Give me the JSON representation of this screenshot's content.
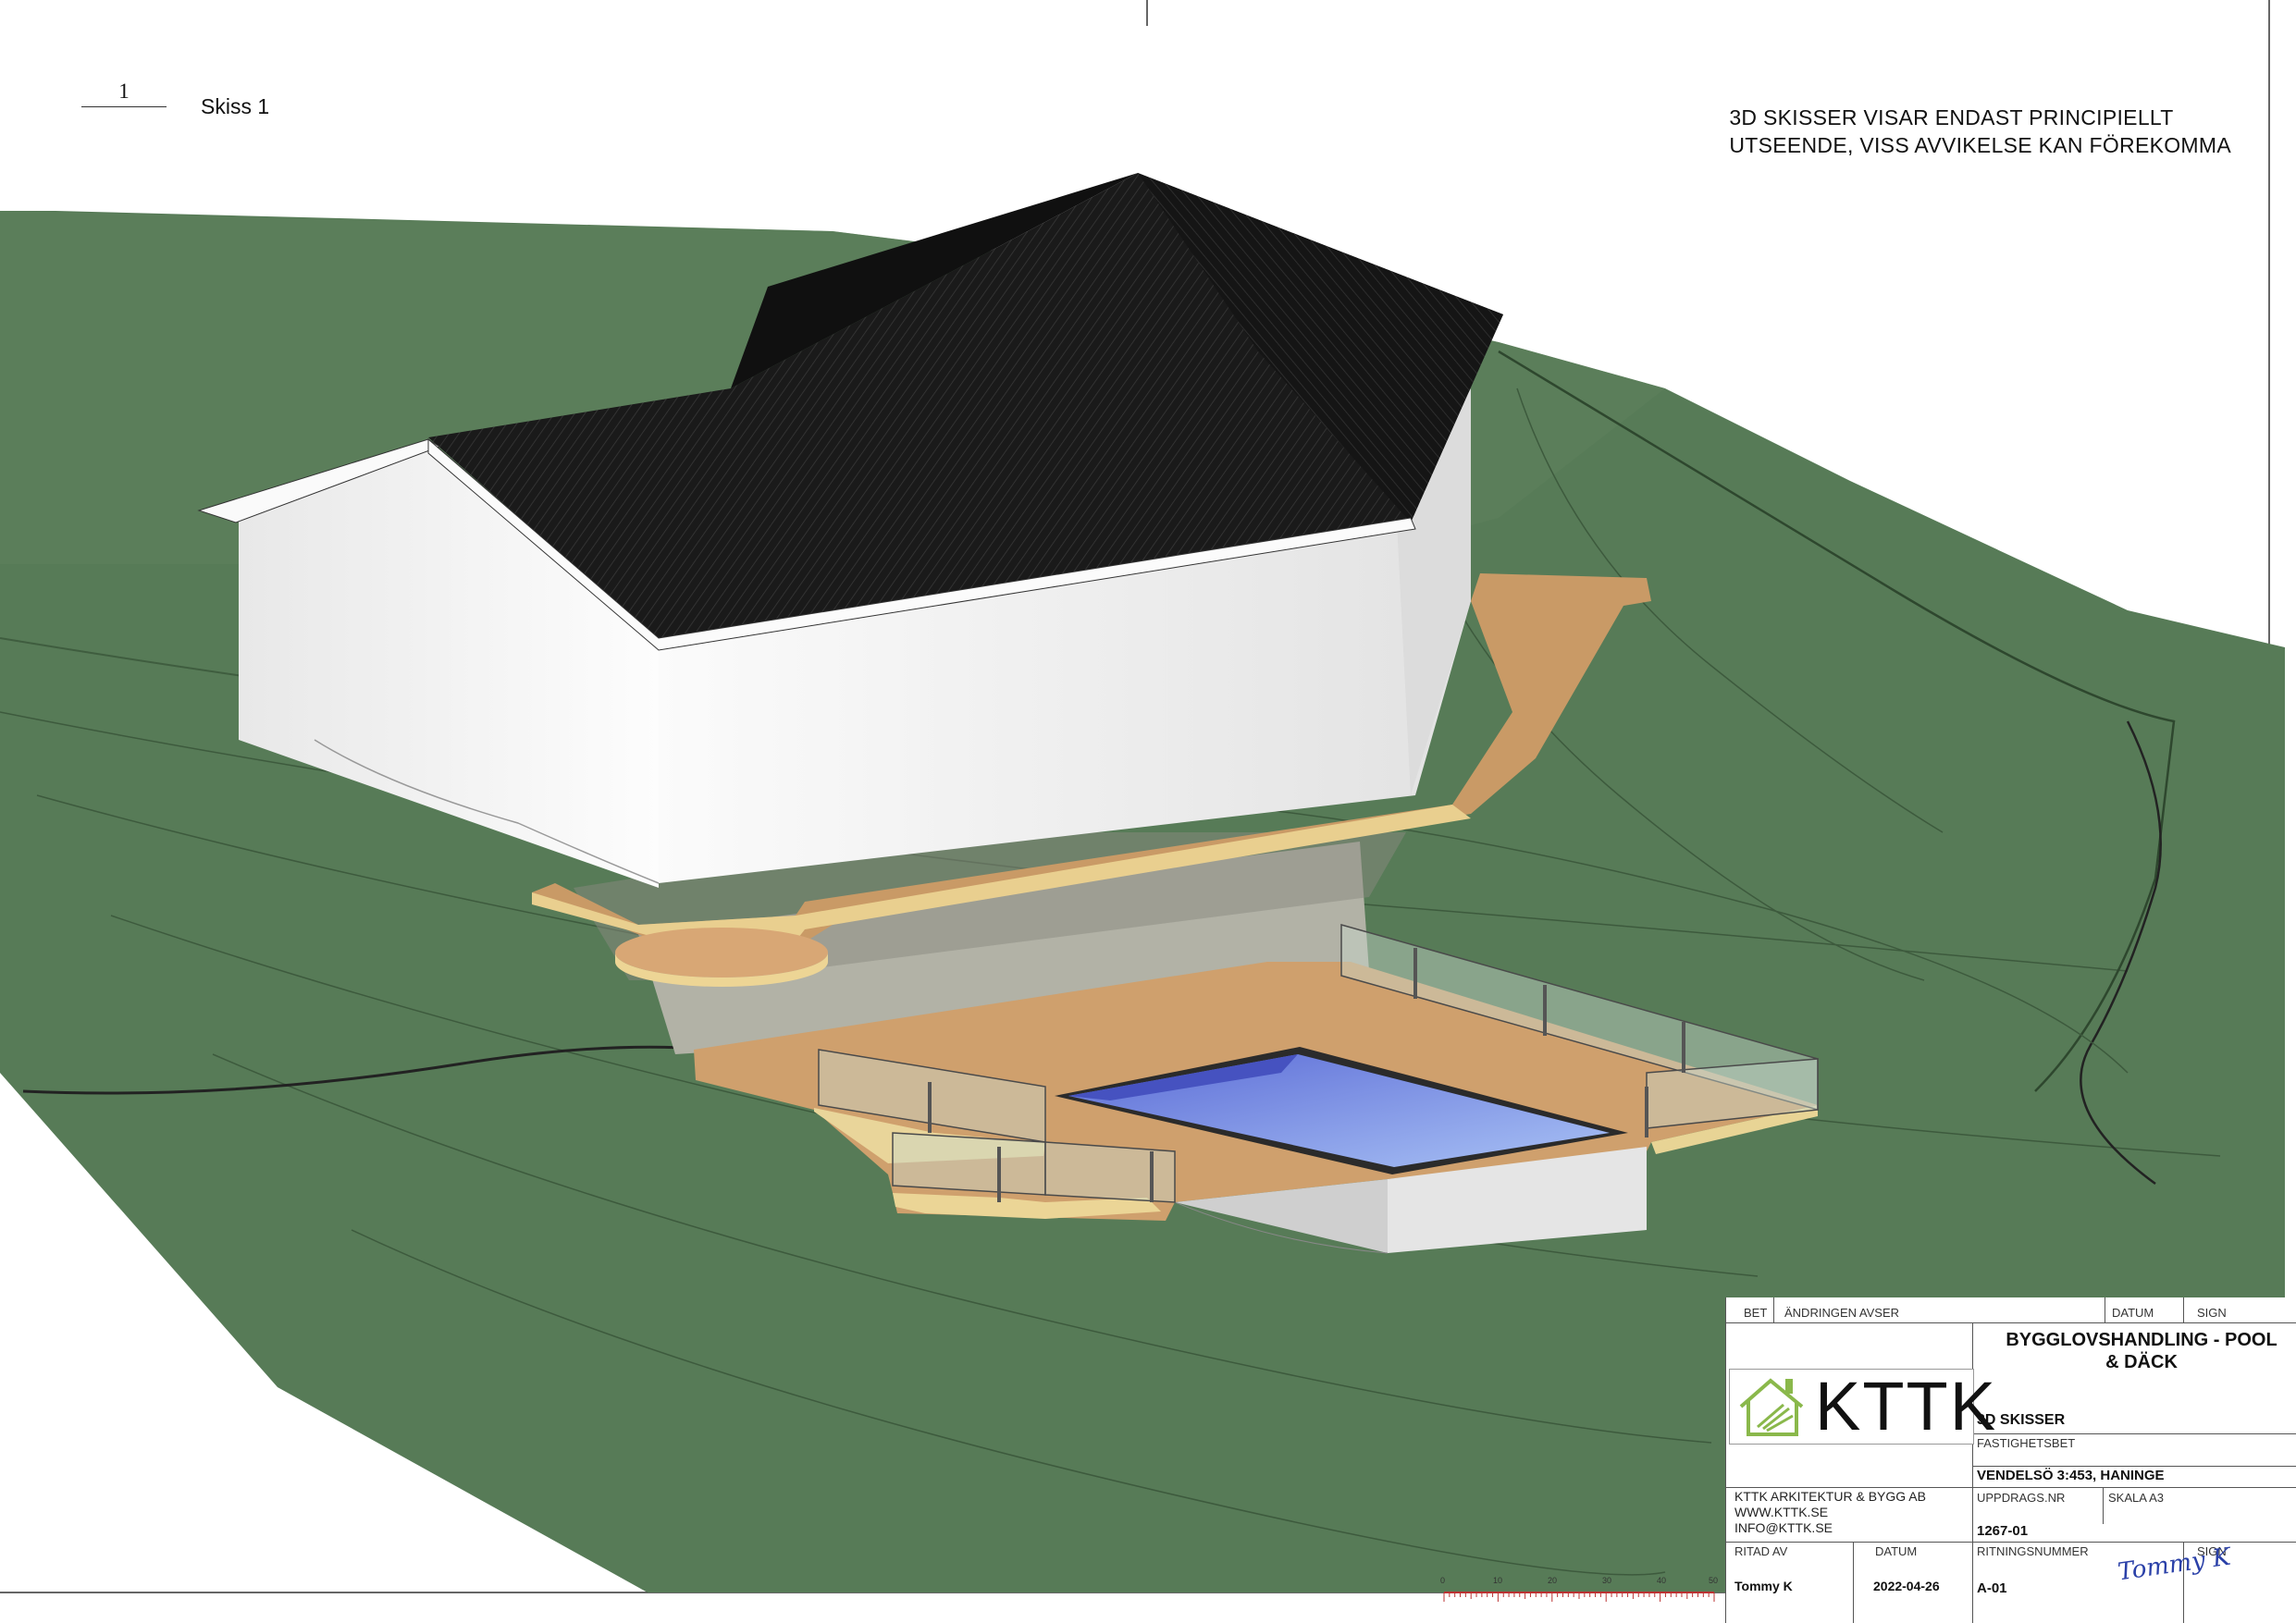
{
  "sheet": {
    "view_number": "1",
    "view_name": "Skiss 1",
    "disclaimer_line1": "3D SKISSER VISAR ENDAST PRINCIPIELLT",
    "disclaimer_line2": "UTSEENDE, VISS AVVIKELSE KAN FÖREKOMMA"
  },
  "titleblock": {
    "bet_label": "BET",
    "change_label": "ÄNDRINGEN AVSER",
    "date_label": "DATUM",
    "sign_label": "SIGN",
    "title": "BYGGLOVSHANDLING - POOL & DÄCK",
    "logo_text": "KTTK",
    "subtitle": "3D SKISSER",
    "property_label": "FASTIGHETSBET",
    "property_value": "VENDELSÖ 3:453, HANINGE",
    "company_name": "KTTK ARKITEKTUR & BYGG AB",
    "company_web": "WWW.KTTK.SE",
    "company_email": "INFO@KTTK.SE",
    "job_label": "UPPDRAGS.NR",
    "scale_label": "SKALA A3",
    "job_value": "1267-01",
    "drawn_by_label": "RITAD AV",
    "drawn_date_label": "DATUM",
    "drawing_number_label": "RITNINGSNUMMER",
    "sign2_label": "SIGN",
    "drawn_by": "Tommy K",
    "drawn_date": "2022-04-26",
    "drawing_number": "A-01",
    "signature": "Tommy K"
  },
  "scale": {
    "ticks": [
      "0",
      "10",
      "20",
      "30",
      "40",
      "50"
    ]
  },
  "colors": {
    "terrain": "#5a7d5a",
    "terrain_dark": "#4a6b4a",
    "roof": "#1b1b1b",
    "wall": "#f4f4f4",
    "deck": "#d2a06d",
    "deck_edge": "#e6c88a",
    "pool_water": "#7f93e8",
    "glass": "#c9d8cf",
    "logo_green": "#8ab84b"
  }
}
